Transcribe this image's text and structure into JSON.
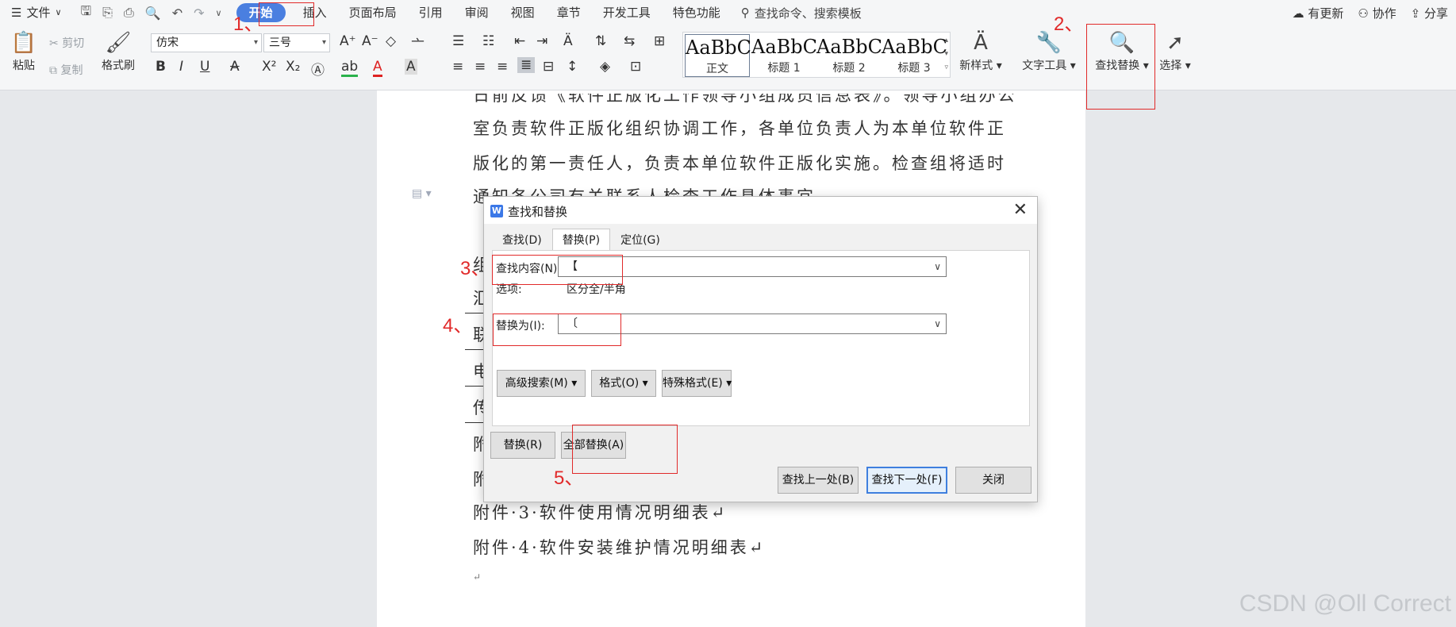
{
  "menubar": {
    "file": "文件",
    "tabs": [
      "开始",
      "插入",
      "页面布局",
      "引用",
      "审阅",
      "视图",
      "章节",
      "开发工具",
      "特色功能"
    ],
    "search_placeholder": "查找命令、搜索模板",
    "right": [
      "有更新",
      "协作",
      "分享"
    ]
  },
  "ribbon": {
    "paste": "粘贴",
    "cut": "剪切",
    "copy": "复制",
    "format_painter": "格式刷",
    "font_name": "仿宋",
    "font_size": "三号",
    "styles": [
      {
        "preview": "AaBbC",
        "name": "正文"
      },
      {
        "preview": "AaBbC",
        "name": "标题 1"
      },
      {
        "preview": "AaBbC",
        "name": "标题 2"
      },
      {
        "preview": "AaBbC",
        "name": "标题 3"
      }
    ],
    "new_style": "新样式",
    "text_tools": "文字工具",
    "find_replace": "查找替换",
    "select": "选择"
  },
  "document": {
    "lines": [
      "日前反馈《软件正版化工作领导小组成员信息表》。领导小组办公",
      "室负责软件正版化组织协调工作，各单位负责人为本单位软件正",
      "版化的第一责任人，负责本单位软件正版化实施。检查组将适时",
      "通知各公司有关联系人检查工作具体事宜。"
    ],
    "fragments": [
      "组",
      "汇",
      "联",
      "电",
      "传",
      "附",
      "附"
    ],
    "attachments": [
      "附件·3·软件使用情况明细表↵",
      "附件·4·软件安装维护情况明细表↵"
    ],
    "end_mark": "↵"
  },
  "dialog": {
    "title": "查找和替换",
    "tabs": [
      "查找(D)",
      "替换(P)",
      "定位(G)"
    ],
    "find_label": "查找内容(N):",
    "find_value": "【",
    "options_label": "选项:",
    "options_value": "区分全/半角",
    "replace_label": "替换为(I):",
    "replace_value": "〔",
    "btn_advanced": "高级搜索(M)",
    "btn_format": "格式(O)",
    "btn_special": "特殊格式(E)",
    "btn_replace": "替换(R)",
    "btn_replace_all": "全部替换(A)",
    "btn_find_prev": "查找上一处(B)",
    "btn_find_next": "查找下一处(F)",
    "btn_close": "关闭"
  },
  "annotations": [
    "1、",
    "2、",
    "3、",
    "4、",
    "5、"
  ],
  "watermark": "CSDN @Oll Correct",
  "colors": {
    "accent": "#4a7fe0",
    "annotation": "#e12a2a"
  }
}
